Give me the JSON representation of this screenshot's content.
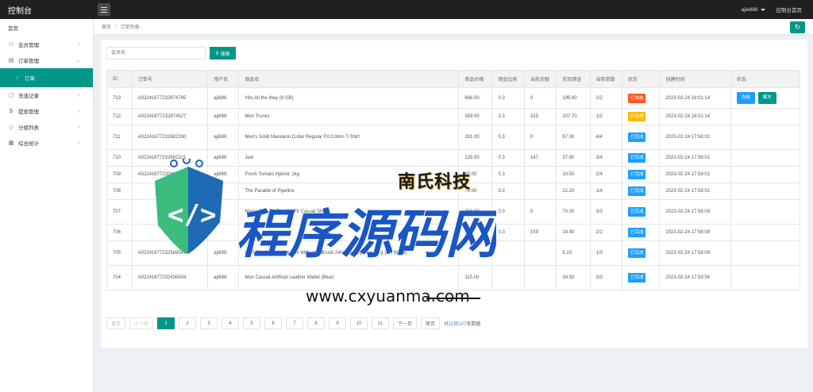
{
  "app": {
    "title": "控制台"
  },
  "header": {
    "user": "ajie888",
    "home_link": "控制台首页"
  },
  "sidebar": {
    "home": "首页",
    "items": [
      {
        "label": "会员管理",
        "icon": "user-icon",
        "expanded": false
      },
      {
        "label": "订单管理",
        "icon": "order-icon",
        "expanded": true
      },
      {
        "label": "订单",
        "icon": "chevron-right-icon",
        "active": true
      },
      {
        "label": "充值记录",
        "icon": "recharge-icon",
        "expanded": false
      },
      {
        "label": "提现管理",
        "icon": "withdraw-icon",
        "expanded": false
      },
      {
        "label": "分组列表",
        "icon": "group-icon",
        "expanded": false
      },
      {
        "label": "综合统计",
        "icon": "stats-icon",
        "expanded": false
      }
    ]
  },
  "breadcrumb": {
    "home": "首页",
    "sep": "/",
    "current": "订单列表"
  },
  "search": {
    "placeholder": "会员名",
    "button": "搜索"
  },
  "table": {
    "columns": [
      "ID",
      "订单号",
      "用户名",
      "商品名",
      "商品价格",
      "佣金比例",
      "当前余额",
      "实际佣金",
      "当前单数",
      "状态",
      "创建时间",
      "状态"
    ],
    "rows": [
      {
        "id": "713",
        "order_no": "A02241677232874745",
        "user": "aji888",
        "product": "Hits All the Way (8 GB)",
        "price": "666.00",
        "rate": "0.3",
        "balance": "0",
        "commission": "199.80",
        "count": "2/2",
        "status": "已冻结",
        "status_color": "#ff5722",
        "time": "2023-02-24 18:01:14",
        "ops": [
          "冻结",
          "解冻"
        ],
        "size": "r1"
      },
      {
        "id": "712",
        "order_no": "A02241677232874527",
        "user": "aji888",
        "product": "Men Trunks",
        "price": "359.00",
        "rate": "0.3",
        "balance": "325",
        "commission": "107.70",
        "count": "1/2",
        "status": "待处理",
        "status_color": "#ffb800",
        "time": "2023-02-24 18:01:14",
        "ops": [],
        "size": "r2"
      },
      {
        "id": "711",
        "order_no": "A02241677232682330",
        "user": "aji888",
        "product": "Men's Solid Mandarin Collar Regular Fit Cotton T-Shirt",
        "price": "291.00",
        "rate": "0.3",
        "balance": "0",
        "commission": "87.30",
        "count": "4/4",
        "status": "已完成",
        "status_color": "#1e9fff",
        "time": "2023-02-24 17:58:02",
        "ops": [],
        "size": "r3"
      },
      {
        "id": "710",
        "order_no": "A02241677232682221",
        "user": "aji888",
        "product": "Jeel",
        "price": "126.00",
        "rate": "0.3",
        "balance": "187",
        "commission": "37.80",
        "count": "3/4",
        "status": "已完成",
        "status_color": "#1e9fff",
        "time": "2023-02-24 17:58:02",
        "ops": [],
        "size": "r2"
      },
      {
        "id": "709",
        "order_no": "A02241677232682110",
        "user": "aji888",
        "product": "Fresh Tomato Hybrid, 1kg",
        "price": "35.00",
        "rate": "0.3",
        "balance": "",
        "commission": "10.50",
        "count": "2/4",
        "status": "已完成",
        "status_color": "#1e9fff",
        "time": "2023-02-24 17:58:02",
        "ops": [],
        "size": "r2"
      },
      {
        "id": "708",
        "order_no": "",
        "user": "",
        "product": "The Parable of Pipeline",
        "price": "74.00",
        "rate": "0.3",
        "balance": "",
        "commission": "22.20",
        "count": "1/4",
        "status": "已完成",
        "status_color": "#1e9fff",
        "time": "2023-02-24 17:58:02",
        "ops": [],
        "size": "r2"
      },
      {
        "id": "707",
        "order_no": "",
        "user": "",
        "product": "Men's Slim Fit Regular Fit Casual Shirt",
        "price": "234.00",
        "rate": "0.3",
        "balance": "0",
        "commission": "70.20",
        "count": "3/3",
        "status": "已完成",
        "status_color": "#1e9fff",
        "time": "2023-02-24 17:56:09",
        "ops": [],
        "size": "r3"
      },
      {
        "id": "706",
        "order_no": "",
        "user": "",
        "product": "",
        "price": "",
        "rate": "0.3",
        "balance": "159",
        "commission": "14.40",
        "count": "2/2",
        "status": "已完成",
        "status_color": "#1e9fff",
        "time": "2023-02-24 17:56:09",
        "ops": [],
        "size": "r2"
      },
      {
        "id": "705",
        "order_no": "A02241677232569547",
        "user": "aji888",
        "product": "ADS 2 in 1 Black Gel Pen With of & Brush 24hrs Gel Eyeline / 7 g (Jet Black)",
        "price": "",
        "rate": "",
        "balance": "",
        "commission": "6.10",
        "count": "1/3",
        "status": "已完成",
        "status_color": "#1e9fff",
        "time": "2023-02-24 17:56:09",
        "ops": [],
        "size": "r3"
      },
      {
        "id": "704",
        "order_no": "A02241677232436504",
        "user": "aji888",
        "product": "Men Casual Artificial Leather Wallet (Blue)",
        "price": "115.00",
        "rate": "",
        "balance": "",
        "commission": "34.50",
        "count": "3/3",
        "status": "已完成",
        "status_color": "#1e9fff",
        "time": "2023-02-24 17:53:56",
        "ops": [],
        "size": "r3"
      }
    ],
    "op_colors": [
      "#1e9fff",
      "#009688"
    ]
  },
  "pager": {
    "first": "首页",
    "prev": "上一页",
    "pages": [
      "1",
      "2",
      "3",
      "4",
      "5",
      "6",
      "7",
      "8",
      "9",
      "10",
      "11"
    ],
    "active": "1",
    "next": "下一页",
    "last": "尾页",
    "total_prefix": "共",
    "total_pages": "11",
    "total_mid": "页",
    "total_count": "107",
    "total_suffix": "条数据"
  },
  "watermark": {
    "main": "程序源码网",
    "url": "www.cxyuanma.com",
    "stamp": "南氏科技"
  }
}
